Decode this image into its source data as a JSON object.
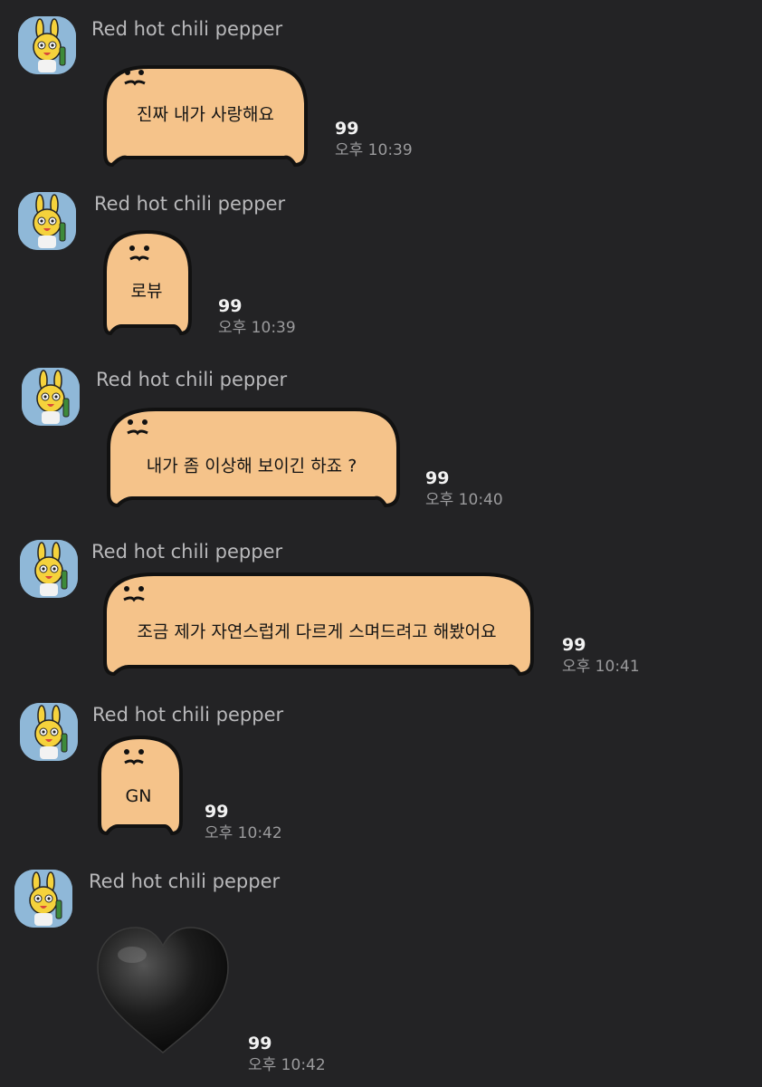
{
  "messages": [
    {
      "sender": "Red hot chili pepper",
      "text": "진짜 내가 사랑해요",
      "unread": "99",
      "time": "오후 10:39"
    },
    {
      "sender": "Red hot chili pepper",
      "text": "로뷰",
      "unread": "99",
      "time": "오후 10:39"
    },
    {
      "sender": "Red hot chili pepper",
      "text": "내가 좀 이상해 보이긴 하죠 ?",
      "unread": "99",
      "time": "오후 10:40"
    },
    {
      "sender": "Red hot chili pepper",
      "text": "조금 제가 자연스럽게 다르게 스며드려고 해봤어요",
      "unread": "99",
      "time": "오후 10:41"
    },
    {
      "sender": "Red hot chili pepper",
      "text": "GN",
      "unread": "99",
      "time": "오후 10:42"
    },
    {
      "sender": "Red hot chili pepper",
      "sticker": "black-heart-icon",
      "unread": "99",
      "time": "오후 10:42"
    }
  ],
  "colors": {
    "background": "#232325",
    "bubble_fill": "#f5c38a",
    "bubble_outline": "#111111",
    "avatar_bg": "#8fb8d8",
    "sender_text": "#b9b9bb",
    "unread_text": "#f2f2f2",
    "time_text": "#9b9b9d"
  }
}
